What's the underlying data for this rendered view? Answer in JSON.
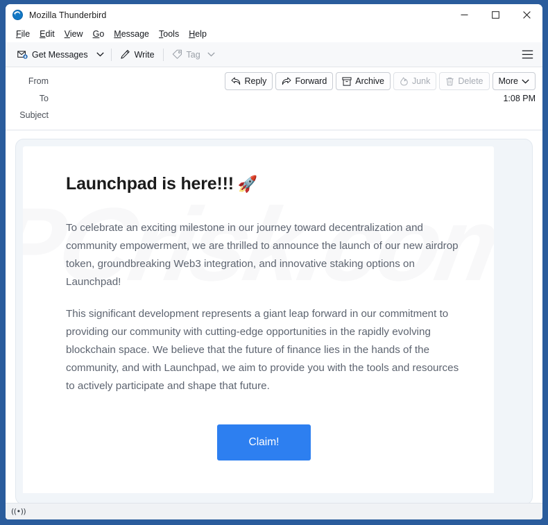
{
  "window": {
    "title": "Mozilla Thunderbird",
    "icon": "thunderbird-icon",
    "controls": {
      "minimize": "minimize-icon",
      "maximize": "maximize-icon",
      "close": "close-icon"
    }
  },
  "menubar": {
    "items": [
      {
        "label": "File",
        "accel": "F"
      },
      {
        "label": "Edit",
        "accel": "E"
      },
      {
        "label": "View",
        "accel": "V"
      },
      {
        "label": "Go",
        "accel": "G"
      },
      {
        "label": "Message",
        "accel": "M"
      },
      {
        "label": "Tools",
        "accel": "T"
      },
      {
        "label": "Help",
        "accel": "H"
      }
    ]
  },
  "toolbar": {
    "get_messages_label": "Get Messages",
    "get_messages_icon": "get-messages-icon",
    "get_messages_caret": "chevron-down-icon",
    "write_label": "Write",
    "write_icon": "pencil-icon",
    "tag_label": "Tag",
    "tag_icon": "tag-icon",
    "tag_caret": "chevron-down-icon",
    "tag_disabled": true,
    "app_menu_icon": "hamburger-icon"
  },
  "message_header": {
    "from_label": "From",
    "from_value": "",
    "to_label": "To",
    "to_value": "",
    "subject_label": "Subject",
    "subject_value": "",
    "time": "1:08 PM",
    "actions": [
      {
        "label": "Reply",
        "icon": "reply-icon",
        "disabled": false
      },
      {
        "label": "Forward",
        "icon": "forward-icon",
        "disabled": false
      },
      {
        "label": "Archive",
        "icon": "archive-icon",
        "disabled": false
      },
      {
        "label": "Junk",
        "icon": "junk-icon",
        "disabled": true
      },
      {
        "label": "Delete",
        "icon": "trash-icon",
        "disabled": true
      },
      {
        "label": "More",
        "icon": "chevron-down-icon",
        "disabled": false
      }
    ]
  },
  "email": {
    "watermark_text": "PCrisk.com",
    "heading": "Launchpad is here!!!",
    "heading_emoji": "🚀",
    "paragraphs": [
      "To celebrate an exciting milestone in our journey toward decentralization and community empowerment, we are thrilled to announce the launch of our new airdrop token, groundbreaking Web3 integration, and innovative staking options on Launchpad!",
      "This significant development represents a giant leap forward in our commitment to providing our community with cutting-edge opportunities in the rapidly evolving blockchain space. We believe that the future of finance lies in the hands of the community, and with Launchpad, we aim to provide you with the tools and resources to actively participate and shape that future."
    ],
    "cta_label": "Claim!",
    "cta_color": "#2d7ff0",
    "cta_text_color": "#ffffff"
  },
  "statusbar": {
    "online_indicator": "((•))",
    "online_icon": "connectivity-icon"
  },
  "colors": {
    "window_frame": "#2a5c9c",
    "toolbar_bg": "#f7f8fa",
    "body_text": "#5d6470",
    "heading_text": "#1b1b1b",
    "card_bg": "#f1f5f9"
  }
}
